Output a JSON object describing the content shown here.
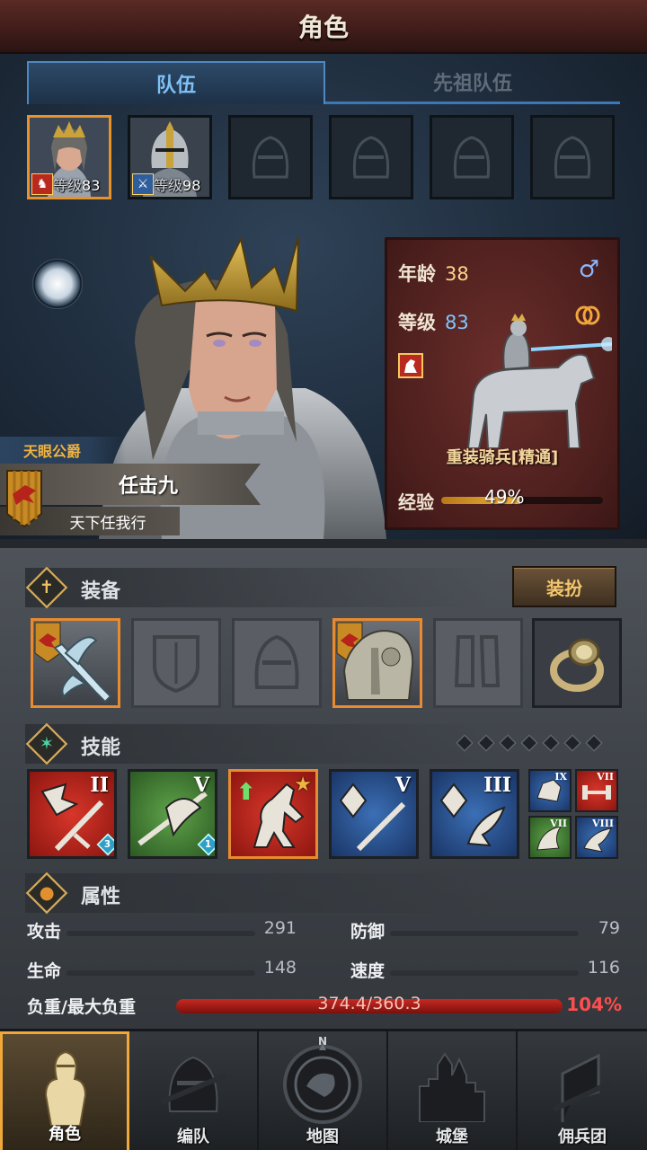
{
  "title": "角色",
  "tabs": {
    "team": "队伍",
    "ancestor": "先祖队伍"
  },
  "team_slots": [
    {
      "level_prefix": "等级",
      "level": "83",
      "badge": "horse-icon"
    },
    {
      "level_prefix": "等级",
      "level": "98",
      "badge": "sword-icon"
    },
    {
      "empty": true
    },
    {
      "empty": true
    },
    {
      "empty": true
    },
    {
      "empty": true
    }
  ],
  "hero": {
    "title": "天眼公爵",
    "name": "任击九",
    "motto": "天下任我行",
    "age_label": "年龄",
    "age": "38",
    "gender_symbol": "♂",
    "level_label": "等级",
    "level": "83",
    "unit_type": "重装骑兵[精通]",
    "exp_label": "经验",
    "exp_percent": "49%",
    "exp_fraction": 0.49
  },
  "equipment": {
    "title": "装备",
    "dress_button": "装扮",
    "slots": [
      {
        "item": "halberd",
        "filled": true
      },
      {
        "item": "shield-slot",
        "filled": false
      },
      {
        "item": "helmet-slot",
        "filled": false
      },
      {
        "item": "plate-armor",
        "filled": true
      },
      {
        "item": "boots-slot",
        "filled": false
      },
      {
        "item": "ring",
        "filled": true
      }
    ]
  },
  "skills": {
    "title": "技能",
    "pip_count": 7,
    "large": [
      {
        "rank": "II",
        "count": "3",
        "color": "red"
      },
      {
        "rank": "V",
        "count": "1",
        "color": "green"
      },
      {
        "rank": "",
        "star": true,
        "color": "red"
      },
      {
        "rank": "V",
        "color": "blue"
      },
      {
        "rank": "III",
        "color": "blue"
      }
    ],
    "small": [
      {
        "rank": "IX",
        "color": "blue"
      },
      {
        "rank": "VII",
        "color": "red"
      },
      {
        "rank": "VII",
        "color": "green"
      },
      {
        "rank": "VIII",
        "color": "blue"
      }
    ]
  },
  "attributes": {
    "title": "属性",
    "attack_label": "攻击",
    "attack": "291",
    "defense_label": "防御",
    "defense": "79",
    "hp_label": "生命",
    "hp": "148",
    "speed_label": "速度",
    "speed": "116",
    "load_label": "负重/最大负重",
    "load_value": "374.4/360.3",
    "load_percent": "104%"
  },
  "nav": [
    {
      "label": "角色",
      "active": true
    },
    {
      "label": "编队"
    },
    {
      "label": "地图"
    },
    {
      "label": "城堡"
    },
    {
      "label": "佣兵团"
    }
  ],
  "compass_letter": "N",
  "colors": {
    "accent_orange": "#e88a30",
    "tab_blue": "#4f88c2",
    "card_red": "#6b2e2b",
    "overload_red": "#ff4d4d"
  }
}
